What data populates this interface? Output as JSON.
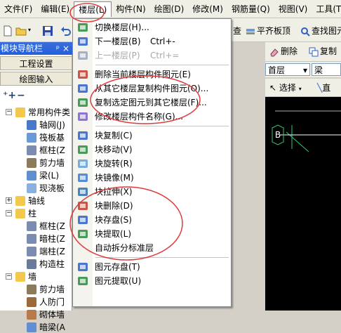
{
  "menubar": [
    {
      "label": "文件(F)"
    },
    {
      "label": "编辑(E)"
    },
    {
      "label": "楼层(L)",
      "active": true
    },
    {
      "label": "构件(N)"
    },
    {
      "label": "绘图(D)"
    },
    {
      "label": "修改(M)"
    },
    {
      "label": "钢筋量(Q)"
    },
    {
      "label": "视图(V)"
    },
    {
      "label": "工具(T)"
    }
  ],
  "toolbar": {
    "query_label": "查",
    "flat_slab_label": "平齐板顶",
    "find_label": "查找图元"
  },
  "nav": {
    "title": "模块导航栏",
    "pin": "ᵖ",
    "close": "×",
    "project_settings": "工程设置",
    "drawing_input": "绘图输入",
    "tree": [
      {
        "label": "常用构件类",
        "level": 0,
        "expander": "−",
        "icon": "folder"
      },
      {
        "label": "轴网(J)",
        "level": 1,
        "icon": "grid"
      },
      {
        "label": "筏板基",
        "level": 1,
        "icon": "slab"
      },
      {
        "label": "框柱(Z",
        "level": 1,
        "icon": "column"
      },
      {
        "label": "剪力墙",
        "level": 1,
        "icon": "wall"
      },
      {
        "label": "梁(L)",
        "level": 1,
        "icon": "beam"
      },
      {
        "label": "现浇板",
        "level": 1,
        "icon": "slab2"
      },
      {
        "label": "轴线",
        "level": 0,
        "expander": "+",
        "icon": "folder"
      },
      {
        "label": "柱",
        "level": 0,
        "expander": "−",
        "icon": "folder"
      },
      {
        "label": "框柱(Z",
        "level": 1,
        "icon": "column"
      },
      {
        "label": "暗柱(Z",
        "level": 1,
        "icon": "column"
      },
      {
        "label": "端柱(Z",
        "level": 1,
        "icon": "column"
      },
      {
        "label": "构造柱",
        "level": 1,
        "icon": "column2"
      },
      {
        "label": "墙",
        "level": 0,
        "expander": "−",
        "icon": "folder"
      },
      {
        "label": "剪力墙",
        "level": 1,
        "icon": "wall"
      },
      {
        "label": "人防门",
        "level": 1,
        "icon": "door"
      },
      {
        "label": "砌体墙",
        "level": 1,
        "icon": "brick"
      },
      {
        "label": "暗梁(A",
        "level": 1,
        "icon": "beam"
      }
    ]
  },
  "right": {
    "delete_label": "删除",
    "copy_label": "复制",
    "floor_combo": "首层",
    "type_combo": "梁",
    "select_label": "选择",
    "line_label": "直",
    "axis_label": "B"
  },
  "floor_menu": [
    {
      "label": "切换楼层(H)...",
      "icon": "switch"
    },
    {
      "label": "下一楼层(B)",
      "shortcut": "Ctrl+-",
      "icon": "down"
    },
    {
      "label": "上一楼层(P)",
      "shortcut": "Ctrl+=",
      "icon": "up",
      "disabled": true
    },
    {
      "separator": true
    },
    {
      "label": "删除当前楼层构件图元(E)",
      "icon": "delete"
    },
    {
      "label": "从其它楼层复制构件图元(O)...",
      "icon": "copyfrom"
    },
    {
      "label": "复制选定图元到其它楼层(F)...",
      "icon": "copyto"
    },
    {
      "label": "修改楼层构件名称(G)...",
      "icon": "rename"
    },
    {
      "separator": true
    },
    {
      "label": "块复制(C)",
      "icon": "blkcopy"
    },
    {
      "label": "块移动(V)",
      "icon": "blkmove"
    },
    {
      "label": "块旋转(R)",
      "icon": "blkrotate"
    },
    {
      "label": "块镜像(M)",
      "icon": "blkmirror"
    },
    {
      "label": "块拉伸(X)",
      "icon": "blkstretch"
    },
    {
      "label": "块删除(D)",
      "icon": "blkdelete"
    },
    {
      "label": "块存盘(S)",
      "icon": "blksave"
    },
    {
      "label": "块提取(L)",
      "icon": "blkload"
    },
    {
      "label": "自动拆分标准层",
      "icon": "none"
    },
    {
      "separator": true
    },
    {
      "label": "图元存盘(T)",
      "icon": "elemsave"
    },
    {
      "label": "图元提取(U)",
      "icon": "elemload"
    }
  ],
  "colors": {
    "accent_blue": "#245edb",
    "canvas_black": "#000000",
    "annotation_red": "#e03a3a",
    "axis_green": "#2ecc71"
  }
}
